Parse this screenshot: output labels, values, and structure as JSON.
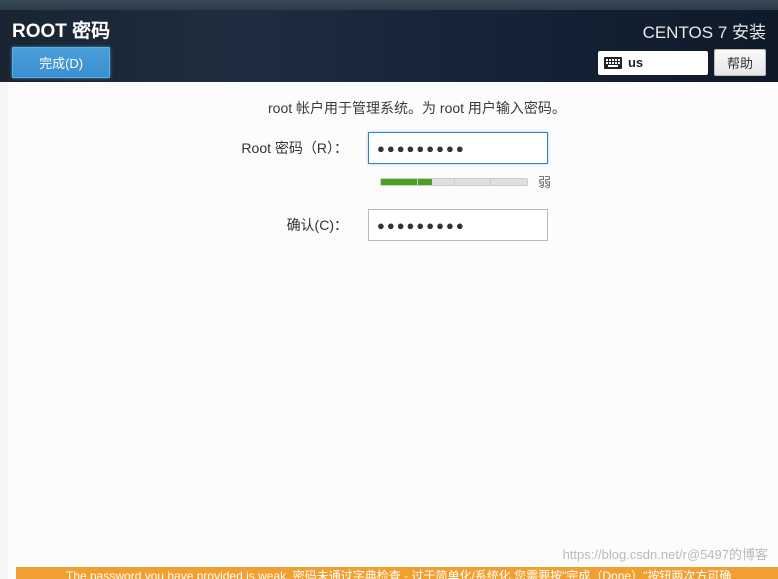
{
  "header": {
    "title": "ROOT 密码",
    "done_label": "完成(D)",
    "installer_title": "CENTOS 7 安装",
    "keyboard_layout": "us",
    "help_label": "帮助"
  },
  "form": {
    "description": "root 帐户用于管理系统。为 root 用户输入密码。",
    "password_label": "Root 密码（R）：",
    "password_value": "●●●●●●●●●",
    "confirm_label": "确认(C)：",
    "confirm_value": "●●●●●●●●●",
    "strength_text": "弱"
  },
  "footer": {
    "warning": "The password you have provided is weak. 密码未通过字典检查 - 过于简单化/系统化 您需要按\"完成（Done）\"按钮两次方可确",
    "watermark": "https://blog.csdn.net/r@5497的博客"
  }
}
